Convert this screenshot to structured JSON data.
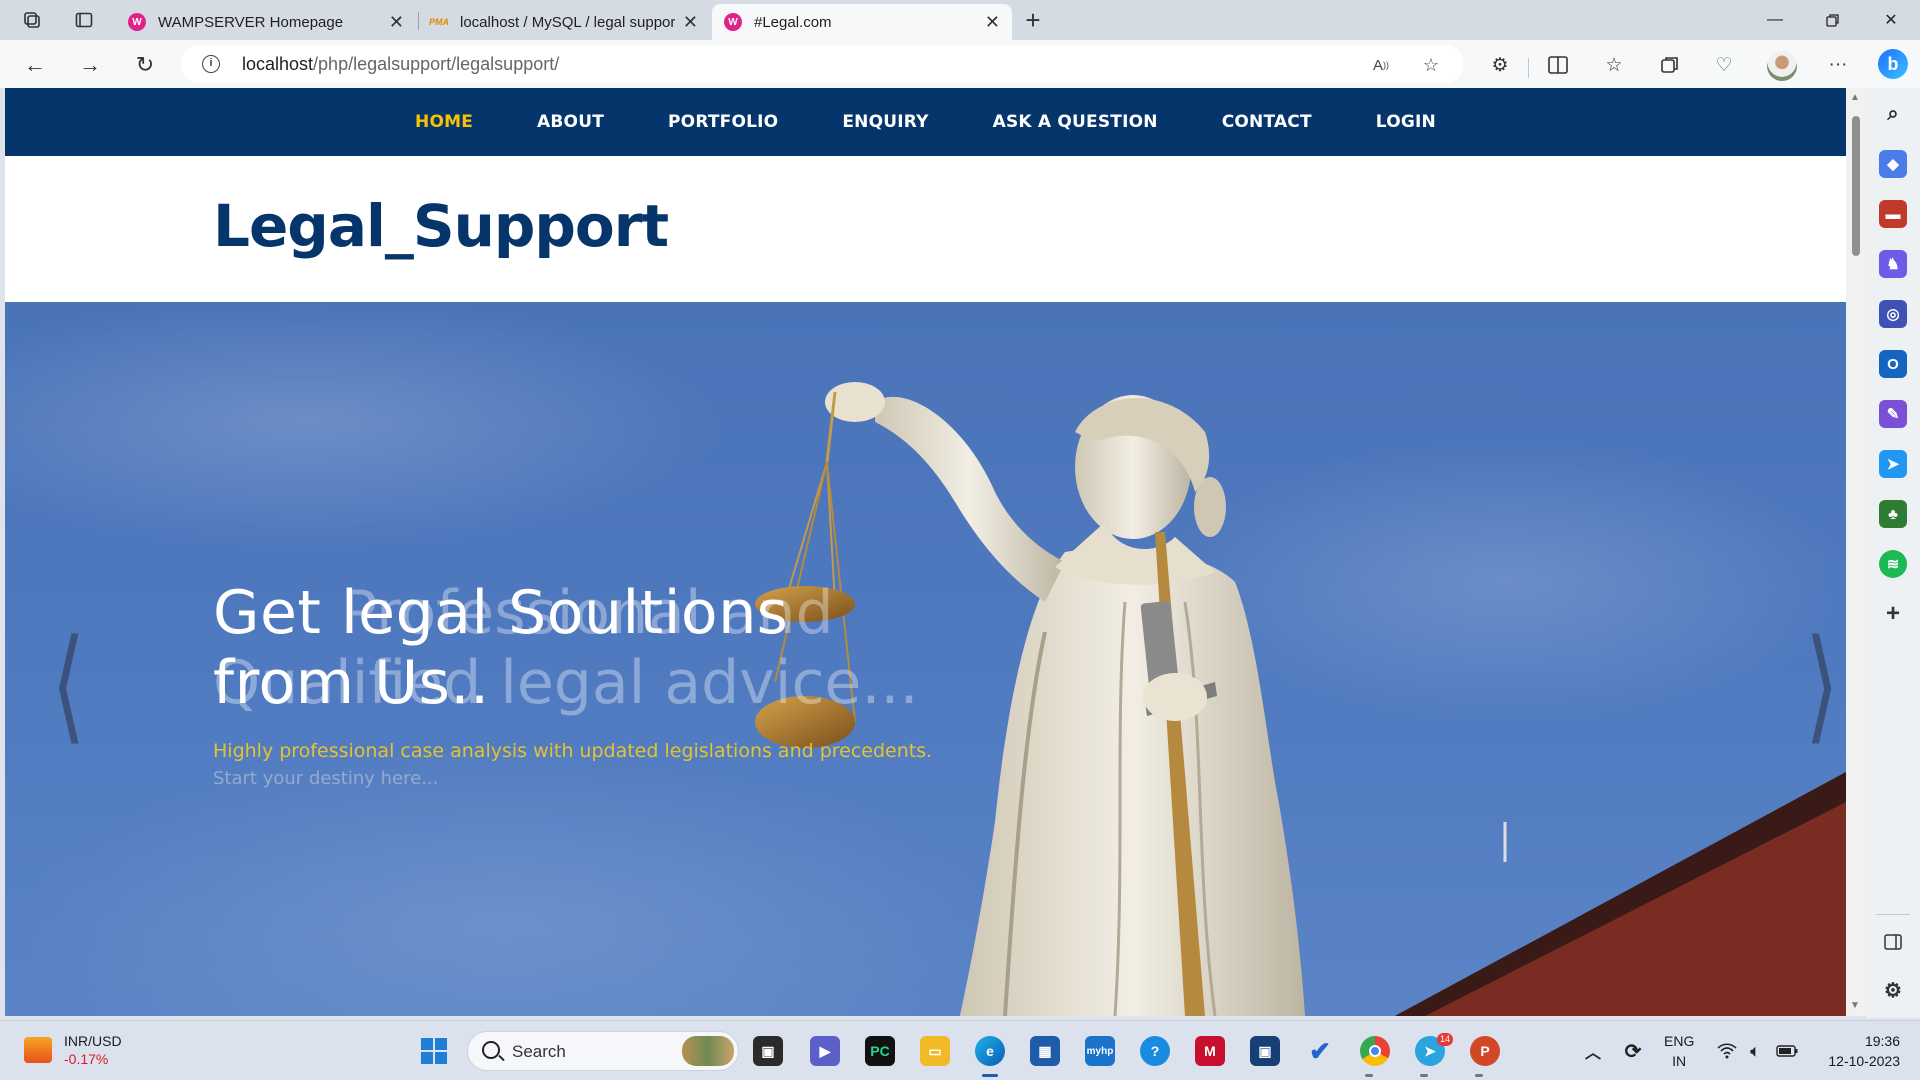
{
  "browser": {
    "tabs": [
      {
        "title": "WAMPSERVER Homepage",
        "favicon": "wampserver-icon",
        "active": false
      },
      {
        "title": "localhost / MySQL / legal suppor",
        "favicon": "phpmyadmin-icon",
        "active": false
      },
      {
        "title": "#Legal.com",
        "favicon": "wampserver-icon",
        "active": true
      }
    ],
    "favicon_text": "W",
    "pma_text": "PMA",
    "url_host": "localhost",
    "url_path": "/php/legalsupport/legalsupport/"
  },
  "site": {
    "nav": [
      {
        "label": "HOME",
        "active": true
      },
      {
        "label": "ABOUT",
        "active": false
      },
      {
        "label": "PORTFOLIO",
        "active": false
      },
      {
        "label": "ENQUIRY",
        "active": false
      },
      {
        "label": "ASK A QUESTION",
        "active": false
      },
      {
        "label": "CONTACT",
        "active": false
      },
      {
        "label": "LOGIN",
        "active": false
      }
    ],
    "brand": "Legal_Support",
    "hero": {
      "headline_line1": "Get legal Soultions",
      "headline_line2": "from Us..",
      "ghost_line1": "Professional and",
      "ghost_line2": "Qualified legal advice...",
      "subtitle": "Highly professional case analysis with updated legislations and precedents.",
      "subtitle_ghost": "Start your destiny here..."
    },
    "colors": {
      "nav_bg": "#06356b",
      "nav_active": "#f7c300",
      "brand": "#06356b",
      "subtitle": "#e5c230"
    }
  },
  "taskbar": {
    "search_placeholder": "Search",
    "weather_title": "INR/USD",
    "weather_value": "-0.17%",
    "lang_line1": "ENG",
    "lang_line2": "IN",
    "time": "19:36",
    "date": "12-10-2023",
    "telegram_badge": "14",
    "apps": [
      "start-icon",
      "search",
      "task-view-icon",
      "teams-icon",
      "pycharm-icon",
      "file-explorer-icon",
      "edge-icon",
      "microsoft-store-icon",
      "myhp-icon",
      "get-help-icon",
      "mcafee-icon",
      "virtualbox-icon",
      "todo-icon",
      "chrome-icon",
      "telegram-icon",
      "powerpoint-icon"
    ]
  }
}
